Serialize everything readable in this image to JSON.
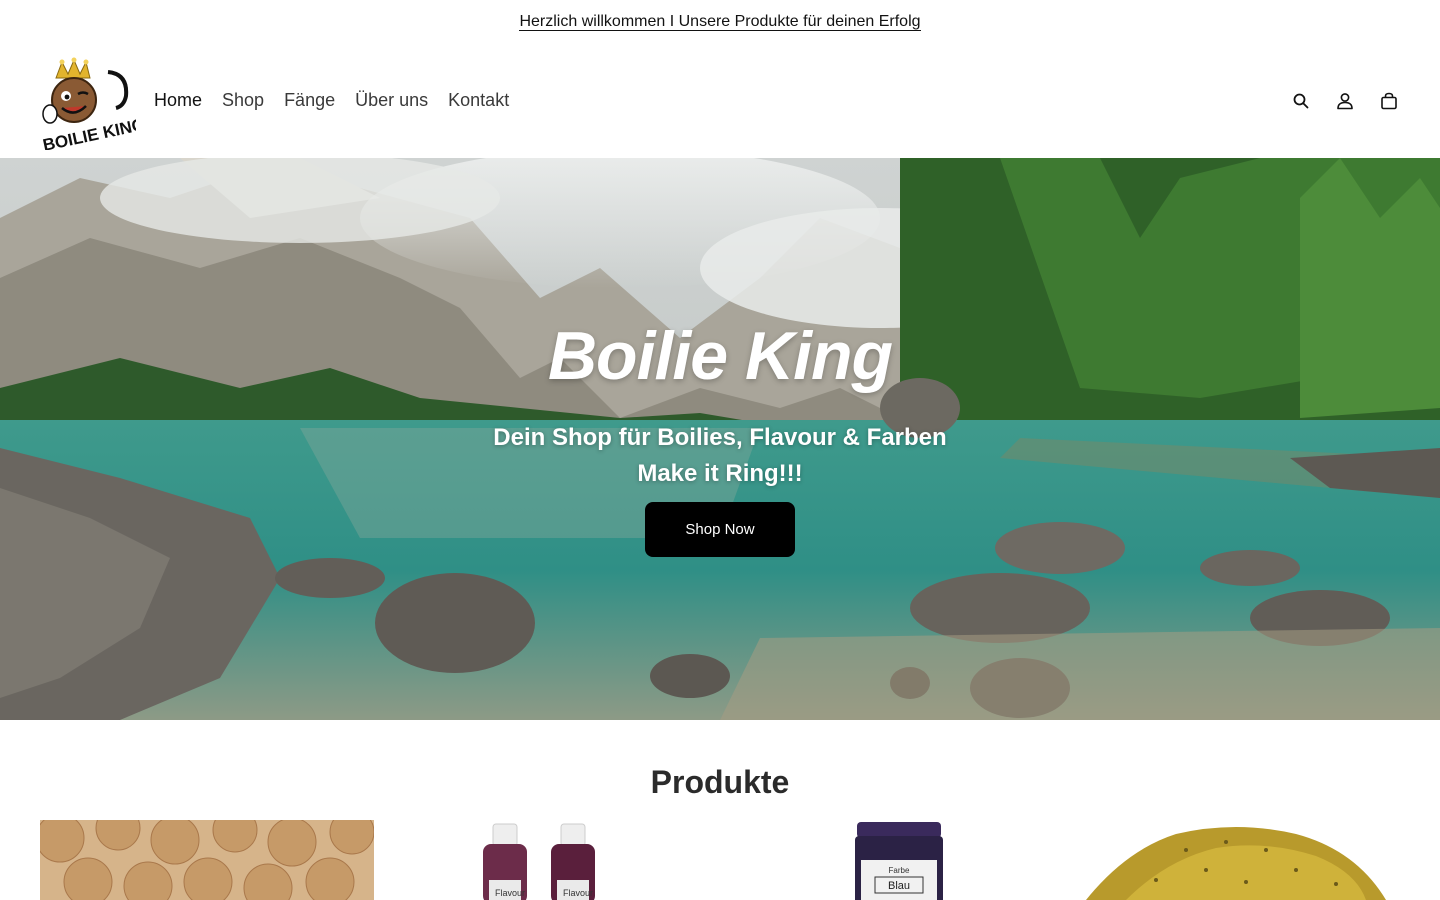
{
  "announcement": {
    "text": "Herzlich willkommen I Unsere Produkte für deinen Erfolg"
  },
  "header": {
    "logo_alt": "BOILIE KING",
    "nav": [
      {
        "label": "Home",
        "active": true
      },
      {
        "label": "Shop"
      },
      {
        "label": "Fänge"
      },
      {
        "label": "Über uns"
      },
      {
        "label": "Kontakt"
      }
    ],
    "icons": [
      "search-icon",
      "account-icon",
      "cart-icon"
    ]
  },
  "hero": {
    "title": "Boilie King",
    "subtitle_line1": "Dein Shop für Boilies, Flavour & Farben",
    "subtitle_line2": "Make it Ring!!!",
    "button_label": "Shop Now"
  },
  "products": {
    "title": "Produkte",
    "items": [
      {
        "image": "boilies"
      },
      {
        "image": "flavour-bottles",
        "label": "Flavour"
      },
      {
        "image": "farbe-jar",
        "label_top": "Farbe",
        "label": "Blau"
      },
      {
        "image": "groundbait"
      }
    ]
  },
  "colors": {
    "accent": "#000000",
    "text": "#121212",
    "water": "#2f8f86"
  }
}
